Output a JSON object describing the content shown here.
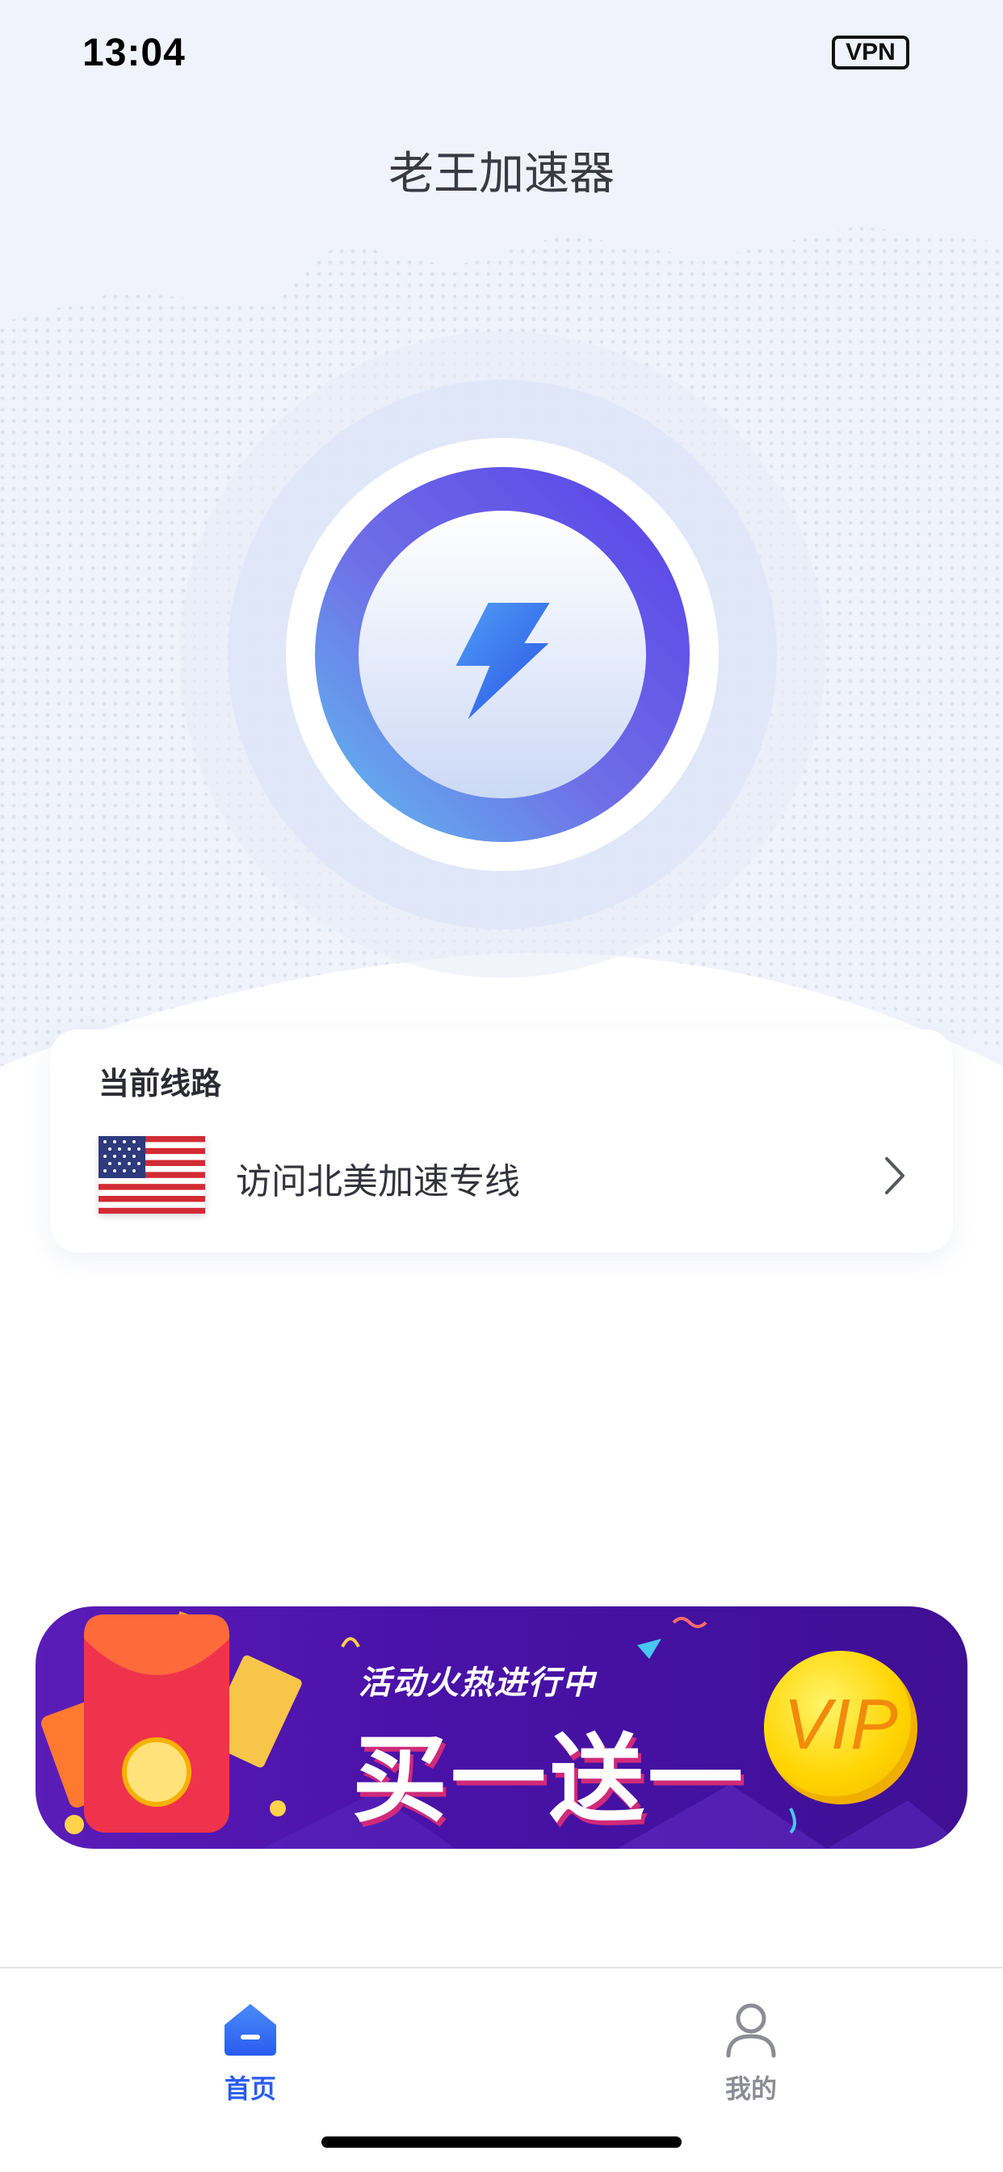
{
  "status_bar": {
    "time": "13:04",
    "vpn_badge": "VPN"
  },
  "header": {
    "title": "老王加速器"
  },
  "connect_button": {
    "icon": "lightning-bolt-icon",
    "accent_color": "#5a4be8"
  },
  "route_card": {
    "caption": "当前线路",
    "route_name": "访问北美加速专线",
    "flag_icon": "us-flag-icon",
    "arrow_icon": "chevron-right-icon"
  },
  "promo_banner": {
    "subtitle": "活动火热进行中",
    "headline": "买一送一",
    "badge": "VIP"
  },
  "tab_bar": {
    "tabs": [
      {
        "label": "首页",
        "icon": "home-icon",
        "active": true,
        "color": "#2a5bf0"
      },
      {
        "label": "我的",
        "icon": "user-icon",
        "active": false,
        "color": "#8c8c94"
      }
    ]
  }
}
